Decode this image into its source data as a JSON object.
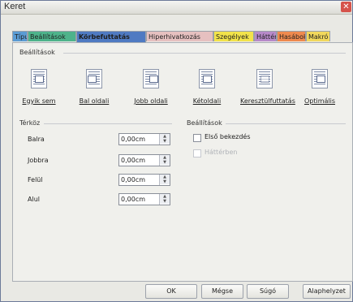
{
  "window": {
    "title": "Keret",
    "close_symbol": "✕"
  },
  "tabs": [
    {
      "label": "Típus",
      "color": "#5a9bd4"
    },
    {
      "label": "Beállítások",
      "color": "#4eb38b"
    },
    {
      "label": "Körbefuttatás",
      "color": "#4f7ac2",
      "active": true
    },
    {
      "label": "Hiperhivatkozás",
      "color": "#e6c0c0"
    },
    {
      "label": "Szegélyek",
      "color": "#f2e34a"
    },
    {
      "label": "Háttér",
      "color": "#b78ac9"
    },
    {
      "label": "Hasábok",
      "color": "#ef8a4f"
    },
    {
      "label": "Makró",
      "color": "#f1d85c"
    }
  ],
  "settings_section": {
    "label": "Beállítások",
    "options": [
      {
        "label": "Egyik sem",
        "icon": "wrap-none-icon"
      },
      {
        "label": "Bal oldali",
        "icon": "wrap-left-icon"
      },
      {
        "label": "Jobb oldali",
        "icon": "wrap-right-icon"
      },
      {
        "label": "Kétoldali",
        "icon": "wrap-parallel-icon"
      },
      {
        "label": "Keresztülfuttatás",
        "icon": "wrap-through-icon"
      },
      {
        "label": "Optimális",
        "icon": "wrap-optimal-icon"
      }
    ]
  },
  "spacing_section": {
    "label": "Térköz",
    "fields": [
      {
        "label": "Balra",
        "value": "0,00cm"
      },
      {
        "label": "Jobbra",
        "value": "0,00cm"
      },
      {
        "label": "Felül",
        "value": "0,00cm"
      },
      {
        "label": "Alul",
        "value": "0,00cm"
      }
    ]
  },
  "options_section": {
    "label": "Beállítások",
    "first_paragraph": "Első bekezdés",
    "in_background": "Háttérben"
  },
  "buttons": {
    "ok": "OK",
    "cancel": "Mégse",
    "help": "Súgó",
    "reset": "Alaphelyzet"
  }
}
